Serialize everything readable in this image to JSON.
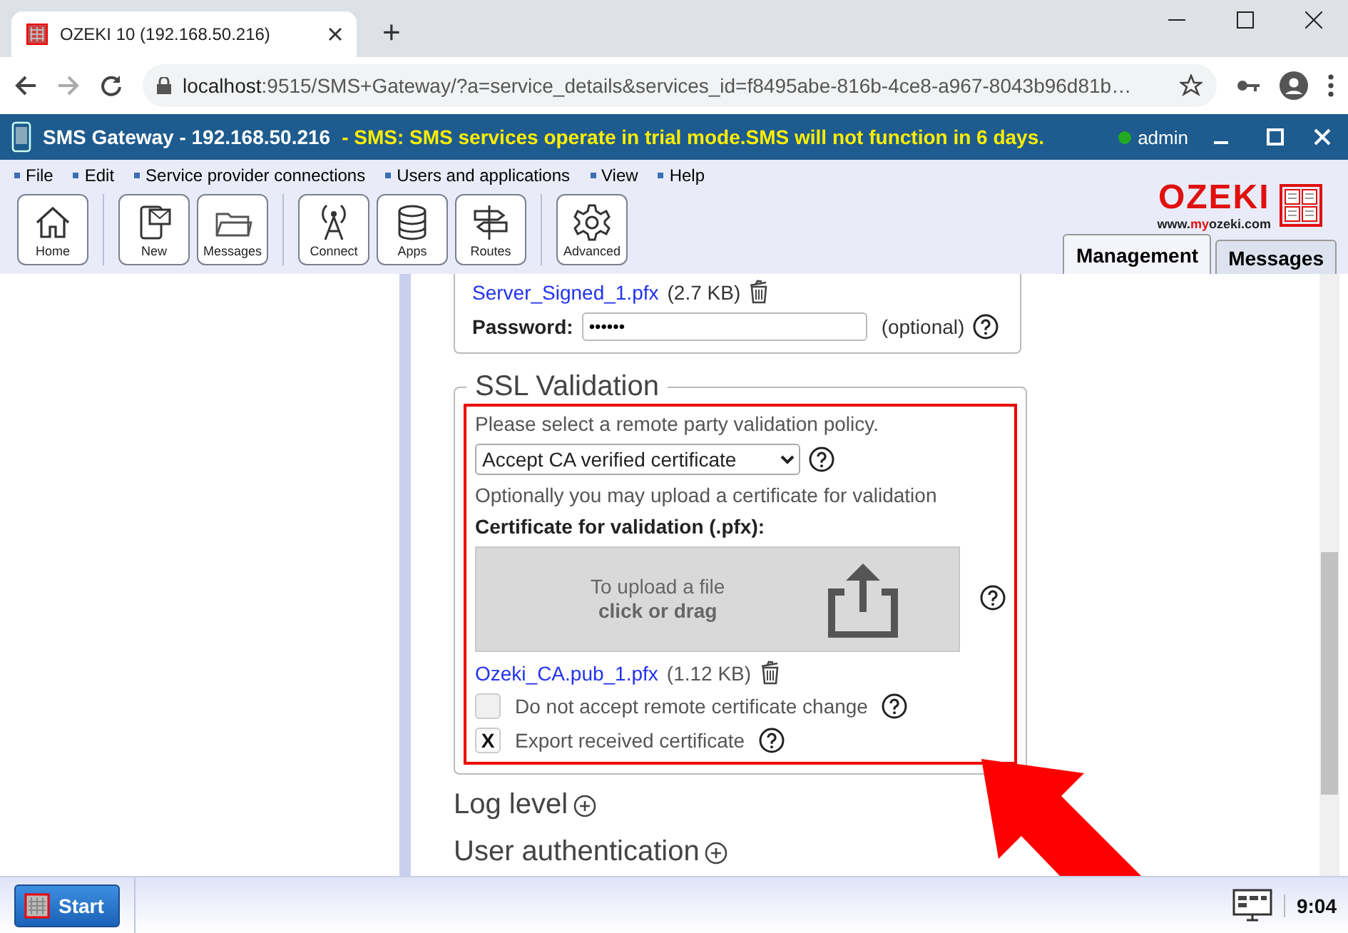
{
  "browser": {
    "tab_title": "OZEKI 10 (192.168.50.216)",
    "new_tab": "+",
    "url_host": "localhost",
    "url_rest": ":9515/SMS+Gateway/?a=service_details&services_id=f8495abe-816b-4ce8-a967-8043b96d81b…"
  },
  "app": {
    "title": "SMS Gateway - 192.168.50.216",
    "notice": "- SMS: SMS services operate in trial mode.SMS will not function in 6 days.",
    "user": "admin",
    "online": true
  },
  "menu": [
    "File",
    "Edit",
    "Service provider connections",
    "Users and applications",
    "View",
    "Help"
  ],
  "toolbar": [
    [
      {
        "label": "Home",
        "kind": "home"
      }
    ],
    [
      {
        "label": "New",
        "kind": "new"
      },
      {
        "label": "Messages",
        "kind": "folder"
      }
    ],
    [
      {
        "label": "Connect",
        "kind": "antenna"
      },
      {
        "label": "Apps",
        "kind": "database"
      },
      {
        "label": "Routes",
        "kind": "signpost"
      }
    ],
    [
      {
        "label": "Advanced",
        "kind": "gear"
      }
    ]
  ],
  "logo": {
    "name": "OZEKI",
    "url_parts": [
      "www.",
      "my",
      "ozeki.com"
    ]
  },
  "view_tabs": [
    {
      "label": "Management",
      "selected": true
    },
    {
      "label": "Messages",
      "selected": false
    }
  ],
  "server_cert": {
    "file": "Server_Signed_1.pfx",
    "size": "(2.7 KB)",
    "password_label": "Password:",
    "password_value": "••••••",
    "optional": "(optional)"
  },
  "ssl": {
    "legend": "SSL Validation",
    "prompt": "Please select a remote party validation policy.",
    "policy": "Accept CA verified certificate",
    "upload_hint": "Optionally you may upload a certificate for validation",
    "cert_label": "Certificate for validation (.pfx):",
    "upload_line1": "To upload a file",
    "upload_line2": "click or drag",
    "file": "Ozeki_CA.pub_1.pfx",
    "size": "(1.12 KB)",
    "check_mark": "X",
    "options": [
      {
        "label": "Do not accept remote certificate change",
        "checked": false
      },
      {
        "label": "Export received certificate",
        "checked": true
      }
    ]
  },
  "sections": [
    {
      "title": "Log level",
      "expanded": false
    },
    {
      "title": "User authentication",
      "expanded": false
    }
  ],
  "taskbar": {
    "start": "Start",
    "clock": "9:04"
  }
}
